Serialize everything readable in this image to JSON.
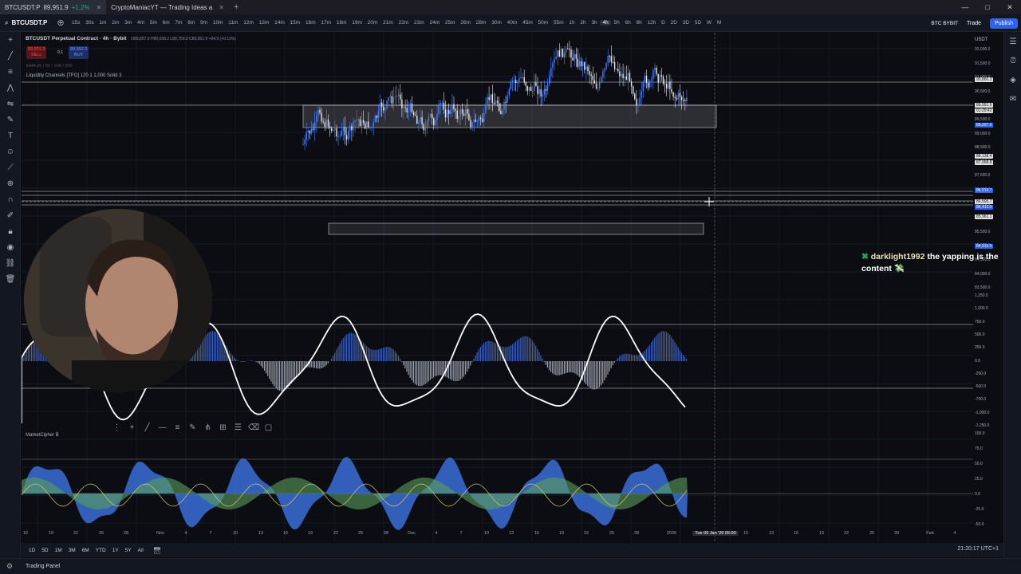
{
  "tabs": [
    {
      "label": "BTCUSDT.P",
      "price": "89,951.9",
      "change": "+1.2%",
      "active": true
    },
    {
      "label": "CryptoManiacYT — Trading Ideas a",
      "active": false
    }
  ],
  "window_controls": [
    "—",
    "□",
    "✕"
  ],
  "toolbar": {
    "symbol": "BTCUSDT.P",
    "timeframes": [
      "15s",
      "30s",
      "1m",
      "2m",
      "3m",
      "4m",
      "5m",
      "6m",
      "7m",
      "8m",
      "9m",
      "10m",
      "11m",
      "12m",
      "13m",
      "14m",
      "15m",
      "16m",
      "17m",
      "18m",
      "19m",
      "20m",
      "21m",
      "22m",
      "23m",
      "24m",
      "25m",
      "26m",
      "28m",
      "30m",
      "40m",
      "45m",
      "50m",
      "55m",
      "1h",
      "2h",
      "3h",
      "4h",
      "5h",
      "6h",
      "8h",
      "12h",
      "D",
      "2D",
      "3D",
      "5D",
      "W",
      "M"
    ],
    "selected_timeframe": "4h",
    "broker": "BTC BYBIT",
    "trade_label": "Trade",
    "publish_label": "Publish"
  },
  "legend": {
    "title": "BTCUSDT Perpetual Contract · 4h · Bybit",
    "ohlc": "O89,857.0 H90,038.2 L89,750.0 C89,951.9 +94.9 (+0.11%)",
    "sell_price": "89,951.9",
    "sell_label": "SELL",
    "spread": "0.1",
    "buy_price": "89,952.0",
    "buy_label": "BUY",
    "ema_line": "EMA 20 / 50 / 100 / 200",
    "indicator": "Liquidity Channels [TFO] 120 1 1,000 Solid 3",
    "market_cipher": "MarketCipher B"
  },
  "price_axis": {
    "currency": "USDT",
    "labels": [
      "92,000.0",
      "91,500.0",
      "91,000.0",
      "90,500.0",
      "90,000.0",
      "89,500.0",
      "89,000.0",
      "88,500.0",
      "88,000.0",
      "87,500.0",
      "87,000.0",
      "86,500.0",
      "86,000.0",
      "85,500.0",
      "85,000.0",
      "84,500.0",
      "84,000.0",
      "83,500.0"
    ],
    "tags": [
      {
        "text": "90,860.3",
        "style": "w"
      },
      {
        "text": "89,951.9",
        "style": "w"
      },
      {
        "text": "01:29:42",
        "style": "w"
      },
      {
        "text": "89,227.5",
        "style": "b"
      },
      {
        "text": "88,138.4",
        "style": "w"
      },
      {
        "text": "87,958.8",
        "style": "w"
      },
      {
        "text": "86,919.7",
        "style": "b"
      },
      {
        "text": "86,505.7",
        "style": "w"
      },
      {
        "text": "86,412.0",
        "style": "b"
      },
      {
        "text": "85,961.1",
        "style": "w"
      },
      {
        "text": "84,915.9",
        "style": "b"
      }
    ],
    "osc_labels": [
      "1,250.0",
      "1,000.0",
      "750.0",
      "500.0",
      "250.0",
      "0.0",
      "-250.0",
      "-500.0",
      "-750.0",
      "-1,000.0",
      "-1,250.0"
    ],
    "mc_labels": [
      "100.0",
      "75.0",
      "50.0",
      "25.0",
      "0.0",
      "-25.0",
      "-50.0"
    ]
  },
  "time_axis": {
    "labels": [
      "16",
      "19",
      "22",
      "25",
      "28",
      "Nov",
      "4",
      "7",
      "10",
      "13",
      "16",
      "19",
      "22",
      "25",
      "28",
      "Dec",
      "4",
      "7",
      "10",
      "13",
      "16",
      "19",
      "22",
      "25",
      "28",
      "2026",
      "10",
      "13",
      "16",
      "19",
      "22",
      "25",
      "28",
      "Feb",
      "4",
      "7"
    ],
    "cursor_label": "Tue 06 Jan '26  05:00"
  },
  "chat": {
    "user": "darklight1992",
    "message": "the yapping is the content",
    "emoji": "💸"
  },
  "bottom": {
    "ranges": [
      "1D",
      "5D",
      "1M",
      "3M",
      "6M",
      "YTD",
      "1Y",
      "5Y",
      "All"
    ],
    "clock": "21:20:17 UTC+1",
    "panel": "Trading Panel"
  },
  "colors": {
    "background": "#0b0d12",
    "accent": "#2962ff",
    "candle_up": "#4a7fff",
    "candle_down": "#e8e8e8"
  }
}
